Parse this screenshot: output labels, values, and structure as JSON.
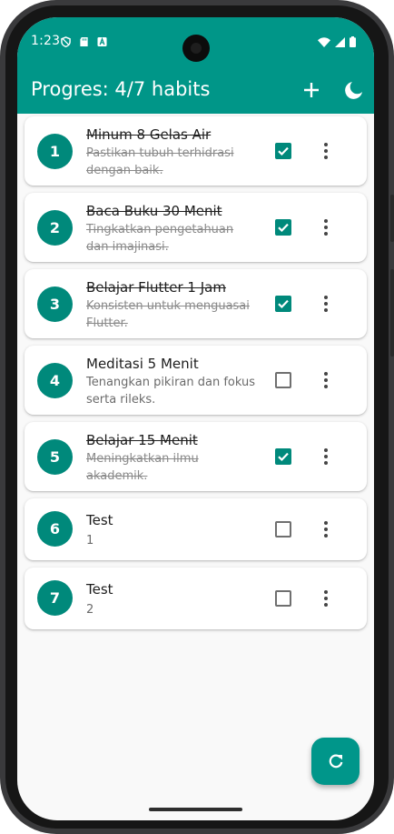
{
  "status": {
    "time": "1:23"
  },
  "appbar": {
    "title": "Progres: 4/7 habits"
  },
  "colors": {
    "primary": "#009688",
    "check": "#00897b"
  },
  "icons": {
    "add": "plus-icon",
    "theme": "dark-mode-moon-icon",
    "refresh": "refresh-icon",
    "menu": "more-vert-icon"
  },
  "habits": [
    {
      "number": "1",
      "title": "Minum 8 Gelas Air",
      "description": "Pastikan tubuh terhidrasi dengan baik.",
      "done": true
    },
    {
      "number": "2",
      "title": "Baca Buku 30 Menit",
      "description": "Tingkatkan pengetahuan dan imajinasi.",
      "done": true
    },
    {
      "number": "3",
      "title": "Belajar Flutter 1 Jam",
      "description": "Konsisten untuk menguasai Flutter.",
      "done": true
    },
    {
      "number": "4",
      "title": "Meditasi 5 Menit",
      "description": "Tenangkan pikiran dan fokus serta rileks.",
      "done": false
    },
    {
      "number": "5",
      "title": "Belajar 15 Menit",
      "description": "Meningkatkan ilmu akademik.",
      "done": true
    },
    {
      "number": "6",
      "title": "Test",
      "description": "1",
      "done": false
    },
    {
      "number": "7",
      "title": "Test",
      "description": "2",
      "done": false
    }
  ]
}
